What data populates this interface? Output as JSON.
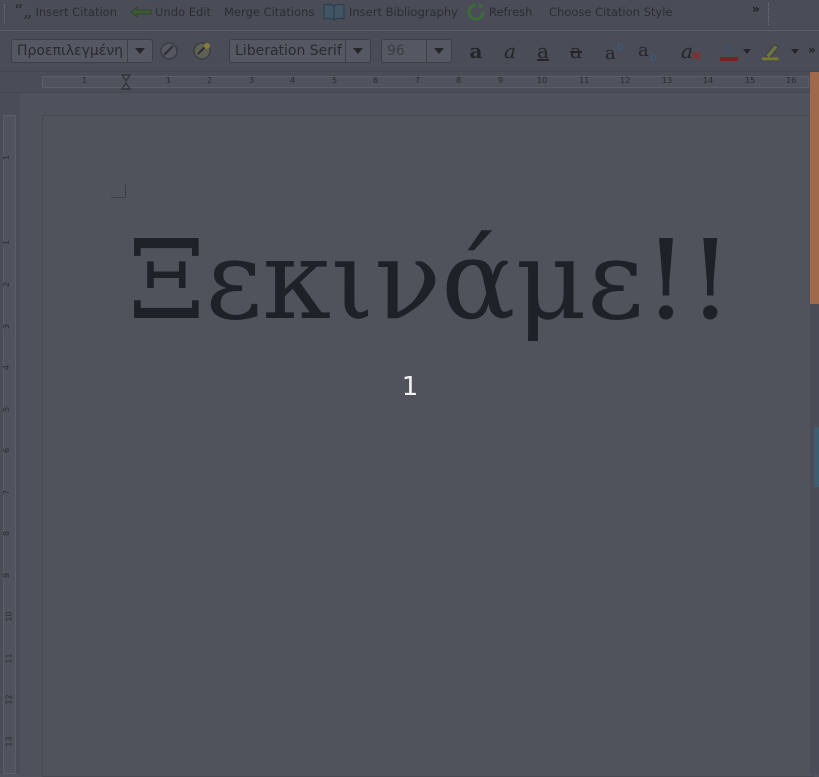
{
  "toolbar_top": {
    "items": [
      {
        "label": "Insert Citation",
        "icon": "quote-icon"
      },
      {
        "label": "Undo Edit",
        "icon": "undo-arrow-icon"
      },
      {
        "label": "Merge Citations",
        "icon": ""
      },
      {
        "label": "Insert Bibliography",
        "icon": "book-icon"
      },
      {
        "label": "Refresh",
        "icon": "refresh-icon"
      },
      {
        "label": "Choose Citation Style",
        "icon": ""
      }
    ],
    "overflow": "»"
  },
  "toolbar_format": {
    "paragraph_style": "Προεπιλεγμένη",
    "font_name": "Liberation Serif",
    "font_size": "96",
    "overflow": "»"
  },
  "ruler": {
    "h_numbers": [
      "1",
      "1",
      "2",
      "3",
      "4",
      "5",
      "6",
      "7",
      "8",
      "9",
      "10",
      "11",
      "12",
      "13",
      "14",
      "15",
      "16"
    ],
    "v_numbers": [
      "1",
      "1",
      "2",
      "3",
      "4",
      "5",
      "6",
      "7",
      "8",
      "9",
      "10",
      "11",
      "12",
      "13"
    ]
  },
  "document": {
    "heading": "Ξεκινάμε!!",
    "page_number": "1"
  },
  "colors": {
    "background": "#4f525c",
    "text": "#1f2128",
    "scroll_accent": "#a06a4a"
  }
}
